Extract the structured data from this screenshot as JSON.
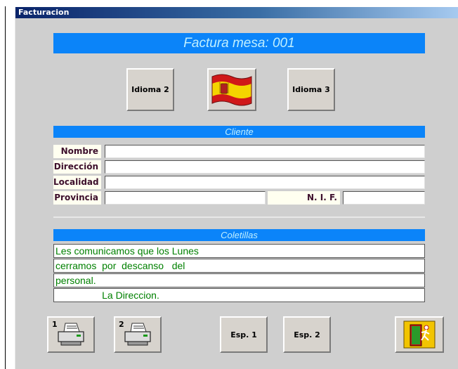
{
  "window": {
    "title": "Facturacion"
  },
  "header": {
    "title": "Factura mesa: 001"
  },
  "language_buttons": {
    "idioma2": "Idioma 2",
    "idioma3": "Idioma 3"
  },
  "cliente": {
    "header": "Cliente",
    "labels": {
      "nombre": "Nombre",
      "direccion": "Dirección",
      "localidad": "Localidad",
      "provincia": "Provincia",
      "nif": "N. I. F."
    },
    "values": {
      "nombre": "",
      "direccion": "",
      "localidad": "",
      "provincia": "",
      "nif": ""
    }
  },
  "coletillas": {
    "header": "Coletillas",
    "lines": [
      "Les comunicamos que los Lunes",
      "cerramos  por  descanso   del",
      "personal.",
      "                 La Direccion."
    ]
  },
  "bottom_buttons": {
    "print1_num": "1",
    "print2_num": "2",
    "esp1": "Esp. 1",
    "esp2": "Esp. 2"
  },
  "colors": {
    "header_bg": "#0b84f9",
    "header_text": "#bfefff",
    "panel_bg": "#cfcfcf",
    "text_green": "#008000"
  },
  "icons": {
    "flag": "spain-flag-icon",
    "printer": "printer-icon",
    "exit": "exit-door-icon"
  }
}
